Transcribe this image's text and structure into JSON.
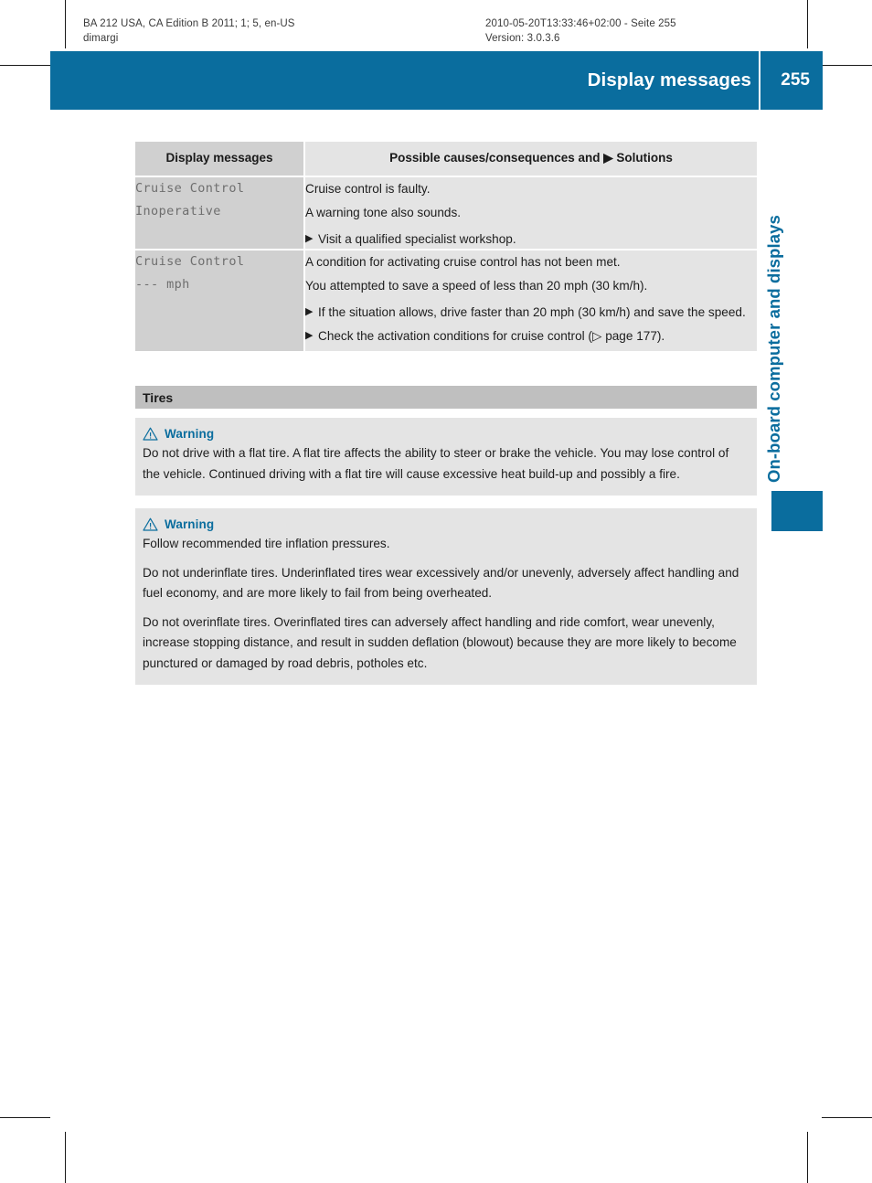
{
  "running_head": {
    "left": "BA 212 USA, CA Edition B 2011; 1; 5, en-US\ndimargi",
    "right": "2010-05-20T13:33:46+02:00 - Seite 255\nVersion: 3.0.3.6"
  },
  "banner": {
    "title": "Display messages",
    "page_number": "255",
    "color": "#0a6d9e"
  },
  "thumb_index": {
    "label": "On-board computer and displays",
    "color": "#0a6d9e"
  },
  "message_table": {
    "headers": {
      "left": "Display messages",
      "right": "Possible causes/consequences and ▶ Solutions"
    },
    "rows": [
      {
        "message": "Cruise Control\nInoperative",
        "lines": [
          "Cruise control is faulty.",
          "A warning tone also sounds."
        ],
        "bullets": [
          {
            "marker": "▶",
            "text": "Visit a qualified specialist workshop."
          }
        ]
      },
      {
        "message": "Cruise Control\n--- mph",
        "lines": [
          "A condition for activating cruise control has not been met.",
          "You attempted to save a speed of less than 20 mph (30 km/h)."
        ],
        "bullets": [
          {
            "marker": "▶",
            "text": "If the situation allows, drive faster than 20 mph (30 km/h) and save the speed."
          },
          {
            "marker": "▶",
            "text": "Check the activation conditions for cruise control (▷ page 177)."
          }
        ]
      }
    ]
  },
  "tires_section": {
    "heading": "Tires",
    "warnings": [
      {
        "icon": "warning-triangle-icon",
        "title": "Warning",
        "paragraphs": [
          "Do not drive with a flat tire. A flat tire affects the ability to steer or brake the vehicle. You may lose control of the vehicle. Continued driving with a flat tire will cause excessive heat build-up and possibly a fire."
        ]
      },
      {
        "icon": "warning-triangle-icon",
        "title": "Warning",
        "paragraphs": [
          "Follow recommended tire inflation pressures.",
          "Do not underinflate tires. Underinflated tires wear excessively and/or unevenly, adversely affect handling and fuel economy, and are more likely to fail from being overheated.",
          "Do not overinflate tires. Overinflated tires can adversely affect handling and ride comfort, wear unevenly, increase stopping distance, and result in sudden deflation (blowout) because they are more likely to become punctured or damaged by road debris, potholes etc."
        ]
      }
    ]
  }
}
